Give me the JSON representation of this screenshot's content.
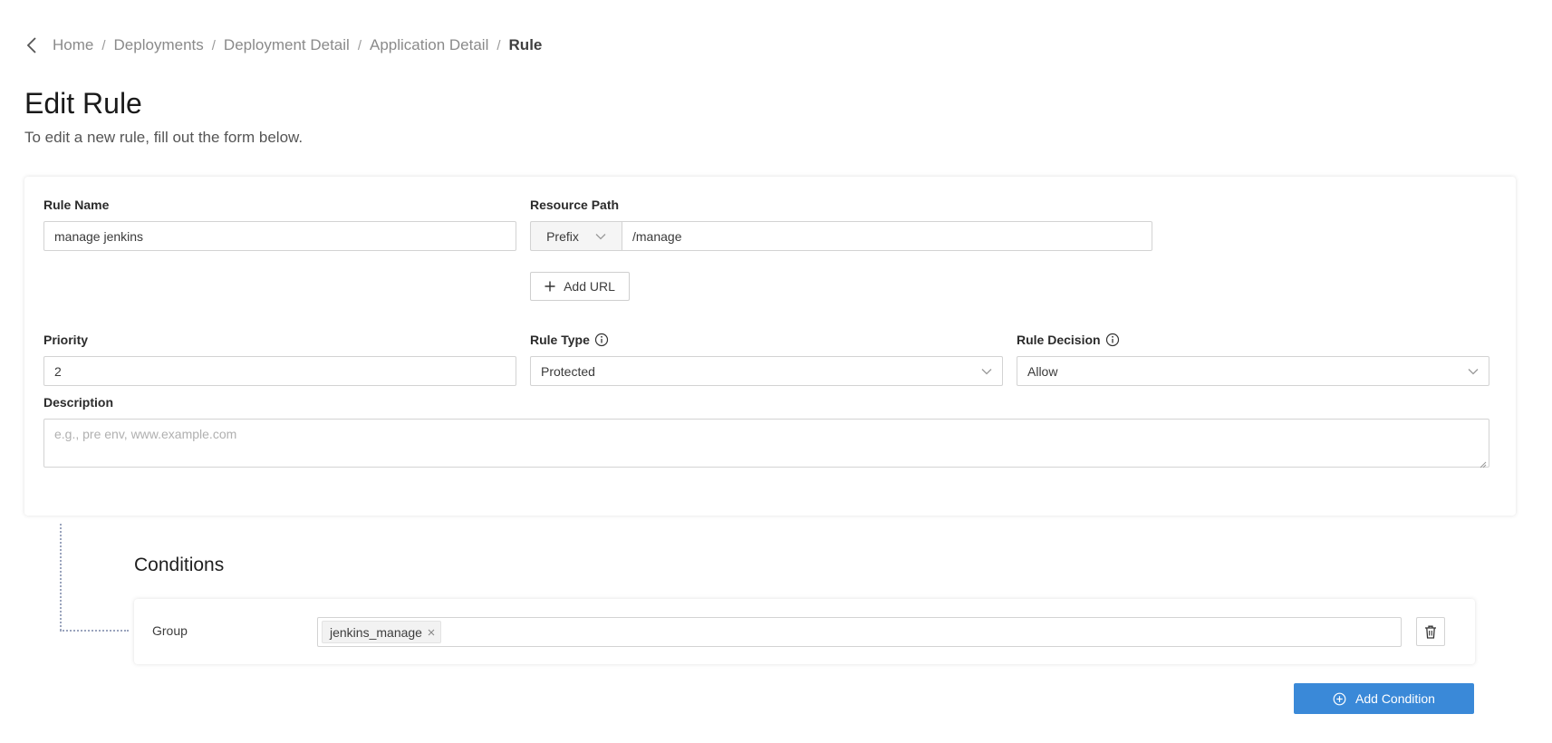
{
  "breadcrumb": {
    "items": [
      "Home",
      "Deployments",
      "Deployment Detail",
      "Application Detail"
    ],
    "current": "Rule",
    "separator": "/"
  },
  "page": {
    "title": "Edit Rule",
    "subtitle": "To edit a new rule, fill out the form below."
  },
  "form": {
    "rule_name": {
      "label": "Rule Name",
      "value": "manage jenkins"
    },
    "resource_path": {
      "label": "Resource Path",
      "match_type": "Prefix",
      "value": "/manage"
    },
    "add_url_label": "Add URL",
    "priority": {
      "label": "Priority",
      "value": "2"
    },
    "rule_type": {
      "label": "Rule Type",
      "value": "Protected"
    },
    "rule_decision": {
      "label": "Rule Decision",
      "value": "Allow"
    },
    "description": {
      "label": "Description",
      "placeholder": "e.g., pre env, www.example.com",
      "value": ""
    }
  },
  "conditions": {
    "title": "Conditions",
    "items": [
      {
        "type": "Group",
        "tags": [
          "jenkins_manage"
        ]
      }
    ],
    "add_label": "Add Condition"
  },
  "colors": {
    "primary": "#3a89d8",
    "connector": "#9aa4bd"
  },
  "icons": {
    "back": "chevron-left-icon",
    "info": "info-circle-icon",
    "dropdown": "chevron-down-icon",
    "add": "plus-icon",
    "delete": "trash-icon",
    "add_condition": "plus-circle-icon",
    "tag_remove": "close-icon"
  }
}
